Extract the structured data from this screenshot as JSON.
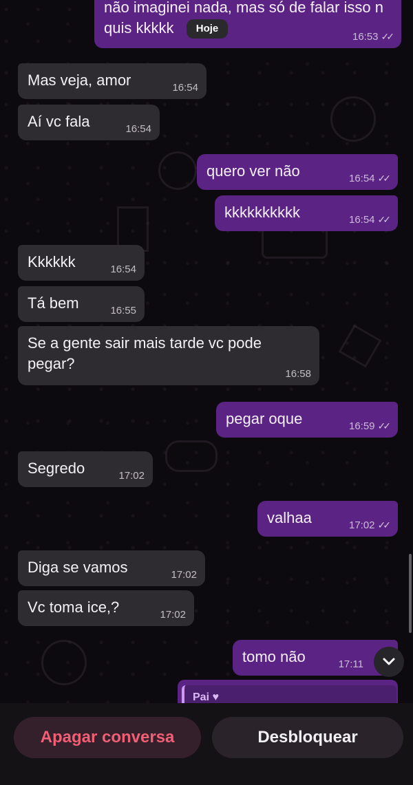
{
  "chat": {
    "date_chip": "Hoje",
    "messages": [
      {
        "dir": "out",
        "text": "não imaginei nada, mas só de falar isso n quis kkkkk",
        "time": "16:53",
        "status": "read"
      },
      {
        "dir": "in",
        "text": "Mas veja, amor",
        "time": "16:54"
      },
      {
        "dir": "in",
        "text": "Aí vc fala",
        "time": "16:54"
      },
      {
        "dir": "out",
        "text": "quero ver não",
        "time": "16:54",
        "status": "read"
      },
      {
        "dir": "out",
        "text": "kkkkkkkkkk",
        "time": "16:54",
        "status": "read"
      },
      {
        "dir": "in",
        "text": "Kkkkkk",
        "time": "16:54"
      },
      {
        "dir": "in",
        "text": "Tá bem",
        "time": "16:55"
      },
      {
        "dir": "in",
        "text": "Se a gente sair mais tarde vc pode pegar?",
        "time": "16:58"
      },
      {
        "dir": "out",
        "text": "pegar oque",
        "time": "16:59",
        "status": "read"
      },
      {
        "dir": "in",
        "text": "Segredo",
        "time": "17:02"
      },
      {
        "dir": "out",
        "text": "valhaa",
        "time": "17:02",
        "status": "read"
      },
      {
        "dir": "in",
        "text": "Diga se vamos",
        "time": "17:02"
      },
      {
        "dir": "in",
        "text": "Vc toma ice,?",
        "time": "17:02"
      },
      {
        "dir": "out",
        "text": "tomo não",
        "time": "17:11",
        "status": "read"
      }
    ],
    "reply_preview": {
      "name": "Pai",
      "heart": "♥"
    }
  },
  "actions": {
    "delete_label": "Apagar conversa",
    "unblock_label": "Desbloquear"
  },
  "icons": {
    "read_ticks": "double-check-icon",
    "scroll_down": "chevron-down-icon"
  },
  "colors": {
    "outgoing_bubble": "#5b2384",
    "incoming_bubble": "#2e2c31",
    "danger_text": "#f05f76"
  }
}
